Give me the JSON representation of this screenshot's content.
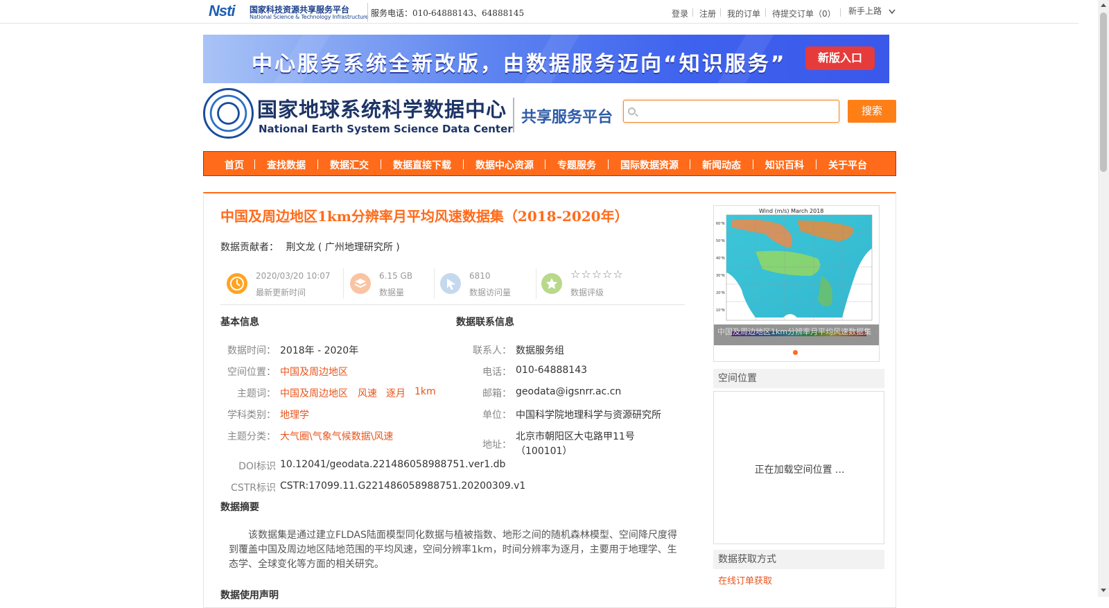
{
  "topbar": {
    "nsti_mark": "Nsti",
    "nsti_cn": "国家科技资源共享服务平台",
    "nsti_en": "National Science & Technology Infrastructure",
    "service_phone": "服务电话：010-64888143、64888145",
    "links": [
      "登录",
      "注册",
      "我的订单",
      "待提交订单（0）"
    ],
    "guide": "新手上路"
  },
  "banner": {
    "text": "中心服务系统全新改版，由数据服务迈向“知识服务”",
    "button": "新版入口"
  },
  "logo": {
    "cn": "国家地球系统科学数据中心",
    "en": "National Earth System Science Data Center",
    "sub": "共享服务平台"
  },
  "search": {
    "placeholder": "",
    "button": "搜索"
  },
  "nav": [
    "首页",
    "查找数据",
    "数据汇交",
    "数据直接下载",
    "数据中心资源",
    "专题服务",
    "国际数据资源",
    "新闻动态",
    "知识百科",
    "关于平台"
  ],
  "dataset": {
    "title": "中国及周边地区1km分辨率月平均风速数据集（2018-2020年）",
    "contributor_label": "数据贡献者：",
    "contributor": "荆文龙 ( 广州地理研究所 )"
  },
  "stats": [
    {
      "value": "2020/03/20 10:07",
      "label": "最新更新时间",
      "icon": "clock-icon",
      "color": "#ffa321"
    },
    {
      "value": "6.15 GB",
      "label": "数据量",
      "icon": "layers-icon",
      "color": "#f9c4a3"
    },
    {
      "value": "6810",
      "label": "数据访问量",
      "icon": "cursor-icon",
      "color": "#c5d9ee"
    },
    {
      "value": "☆☆☆☆☆",
      "label": "数据评级",
      "icon": "star-icon",
      "color": "#b8d98a",
      "rating": 0
    }
  ],
  "basic": {
    "heading": "基本信息",
    "time_label": "数据时间：",
    "time": "2018年 - 2020年",
    "space_label": "空间位置：",
    "space": "中国及周边地区",
    "keywords_label": "主题词：",
    "keywords": [
      "中国及周边地区",
      "风速",
      "逐月",
      "1km"
    ],
    "subject_label": "学科类别：",
    "subject": "地理学",
    "category_label": "主题分类：",
    "category": "大气圈\\气象气候数据\\风速",
    "doi_label": "DOI标识",
    "doi": "10.12041/geodata.221486058988751.ver1.db",
    "cstr_label": "CSTR标识",
    "cstr": "CSTR:17099.11.G221486058988751.20200309.v1"
  },
  "contact": {
    "heading": "数据联系信息",
    "person_label": "联系人：",
    "person": "数据服务组",
    "phone_label": "电话：",
    "phone": "010-64888143",
    "email_label": "邮箱：",
    "email": "geodata@igsnrr.ac.cn",
    "unit_label": "单位：",
    "unit": "中国科学院地理科学与资源研究所",
    "address_label": "地址：",
    "address1": "北京市朝阳区大屯路甲11号",
    "address2": "（100101）"
  },
  "abstract": {
    "heading": "数据摘要",
    "text": "该数据集是通过建立FLDAS陆面模型同化数据与植被指数、地形之间的随机森林模型、空间降尺度得到覆盖中国及周边地区陆地范围的平均风速，空间分辨率1km，时间分辨率为逐月，主要用于地理学、生态学、全球变化等方面的相关研究。"
  },
  "usage_heading": "数据使用声明",
  "preview": {
    "map_title": "Wind (m/s) March 2018",
    "caption": "中国及周边地区1km分辨率月平均风速数据集（2018-2020年）",
    "lat_labels": [
      "60°N",
      "50°N",
      "40°N",
      "30°N",
      "20°N",
      "10°N"
    ]
  },
  "side": {
    "spatial_heading": "空间位置",
    "spatial_loading": "正在加载空间位置 ...",
    "access_heading": "数据获取方式",
    "access_link": "在线订单获取"
  }
}
